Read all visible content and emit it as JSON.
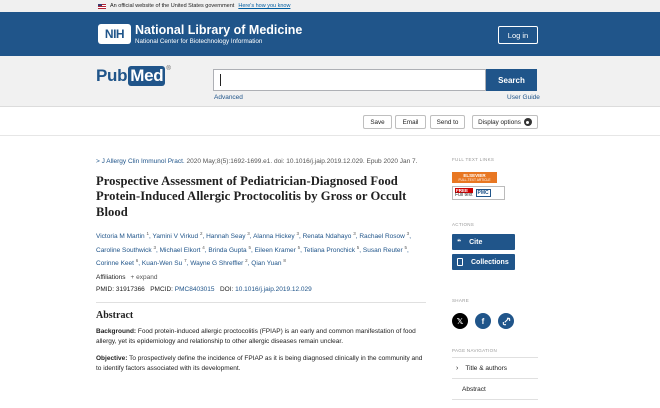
{
  "banner": {
    "text": "An official website of the United States government",
    "link": "Here's how you know"
  },
  "header": {
    "nih": "NIH",
    "title": "National Library of Medicine",
    "subtitle": "National Center for Biotechnology Information",
    "login": "Log in"
  },
  "search": {
    "logo_pub": "Pub",
    "logo_med": "Med",
    "logo_reg": "®",
    "button": "Search",
    "advanced": "Advanced",
    "user_guide": "User Guide"
  },
  "toolbar": {
    "save": "Save",
    "email": "Email",
    "send_to": "Send to",
    "display_options": "Display options"
  },
  "article": {
    "journal_arrow": ">",
    "journal": "J Allergy Clin Immunol Pract.",
    "citation": "2020 May;8(5):1692-1699.e1. doi: 10.1016/j.jaip.2019.12.029. Epub 2020 Jan 7.",
    "title": "Prospective Assessment of Pediatrician-Diagnosed Food Protein-Induced Allergic Proctocolitis by Gross or Occult Blood",
    "authors": [
      {
        "name": "Victoria M Martin",
        "sup": "1"
      },
      {
        "name": "Yamini V Virkud",
        "sup": "2"
      },
      {
        "name": "Hannah Seay",
        "sup": "3"
      },
      {
        "name": "Alanna Hickey",
        "sup": "3"
      },
      {
        "name": "Renata Ndahayo",
        "sup": "3"
      },
      {
        "name": "Rachael Rosow",
        "sup": "3"
      },
      {
        "name": "Caroline Southwick",
        "sup": "3"
      },
      {
        "name": "Michael Elkort",
        "sup": "4"
      },
      {
        "name": "Brinda Gupta",
        "sup": "5"
      },
      {
        "name": "Eileen Kramer",
        "sup": "5"
      },
      {
        "name": "Tetiana Pronchick",
        "sup": "5"
      },
      {
        "name": "Susan Reuter",
        "sup": "5"
      },
      {
        "name": "Corinne Keet",
        "sup": "6"
      },
      {
        "name": "Kuan-Wen Su",
        "sup": "7"
      },
      {
        "name": "Wayne G Shreffler",
        "sup": "2"
      },
      {
        "name": "Qian Yuan",
        "sup": "8"
      }
    ],
    "affiliations": "Affiliations",
    "expand": "+ expand",
    "pmid_label": "PMID:",
    "pmid": "31917366",
    "pmcid_label": "PMCID:",
    "pmcid": "PMC8403015",
    "doi_label": "DOI:",
    "doi": "10.1016/j.jaip.2019.12.029",
    "abstract_heading": "Abstract",
    "background_label": "Background:",
    "background": "Food protein-induced allergic proctocolitis (FPIAP) is an early and common manifestation of food allergy, yet its epidemiology and relationship to other allergic diseases remain unclear.",
    "objective_label": "Objective:",
    "objective": "To prospectively define the incidence of FPIAP as it is being diagnosed clinically in the community and to identify factors associated with its development."
  },
  "sidebar": {
    "full_text_links": "FULL TEXT LINKS",
    "elsevier_1": "ELSEVIER",
    "elsevier_2": "FULL-TEXT ARTICLE",
    "free": "FREE",
    "full_text": "Full text",
    "pmc": "PMC",
    "actions": "ACTIONS",
    "cite": "Cite",
    "collections": "Collections",
    "share": "SHARE",
    "page_navigation": "PAGE NAVIGATION",
    "nav_items": [
      "Title & authors",
      "Abstract"
    ]
  },
  "colors": {
    "brand": "#20558a",
    "twitter": "#000000",
    "facebook": "#20558a",
    "link": "#20558a"
  }
}
